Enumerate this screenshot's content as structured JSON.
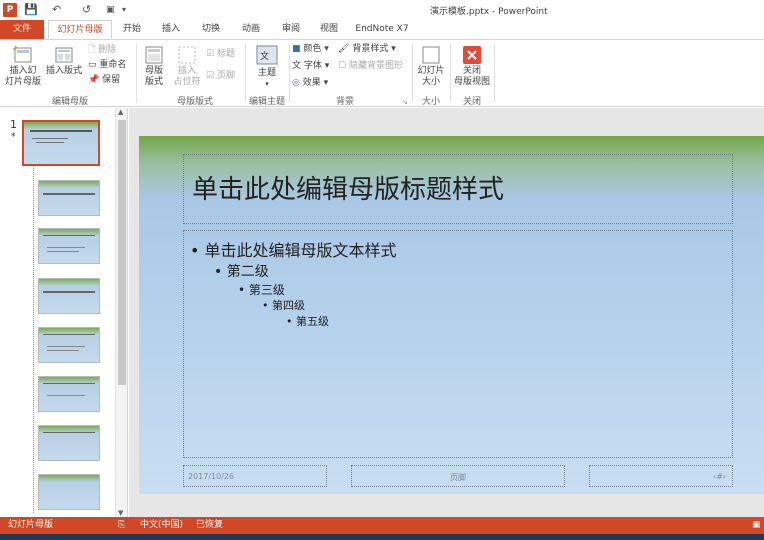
{
  "window": {
    "title": "演示模板.pptx - PowerPoint"
  },
  "qat": {
    "save": "💾",
    "undo": "↶",
    "redo": "↺"
  },
  "tabs": [
    "文件",
    "幻灯片母版",
    "开始",
    "插入",
    "切换",
    "动画",
    "审阅",
    "视图",
    "EndNote X7"
  ],
  "ribbon": {
    "insert_master": "插入幻\n灯片母版",
    "insert_layout": "插入版式",
    "delete": "删除",
    "rename": "重命名",
    "preserve": "保留",
    "group_edit_master": "编辑母版",
    "master_layout": "母版\n版式",
    "insert_placeholder": "插入\n占位符",
    "cb_title": "标题",
    "cb_footer": "页脚",
    "group_master_layout": "母版版式",
    "theme": "主题",
    "group_edit_theme": "编辑主题",
    "colors": "颜色",
    "fonts": "字体",
    "effects": "效果",
    "bg_styles": "背景样式",
    "hide_bg": "隐藏背景图形",
    "group_background": "背景",
    "slide_size": "幻灯片\n大小",
    "group_size": "大小",
    "close_master": "关闭\n母版视图",
    "group_close": "关闭"
  },
  "thumbnail_pane": {
    "slide_number": "1",
    "star": "*"
  },
  "slide": {
    "title": "单击此处编辑母版标题样式",
    "levels": [
      "单击此处编辑母版文本样式",
      "第二级",
      "第三级",
      "第四级",
      "第五级"
    ],
    "date": "2017/10/26",
    "footer": "页脚",
    "number": "‹#›"
  },
  "status": {
    "view": "幻灯片母版",
    "language": "中文(中国)",
    "recovered": "已恢复"
  },
  "colors": {
    "accent": "#d24726"
  }
}
